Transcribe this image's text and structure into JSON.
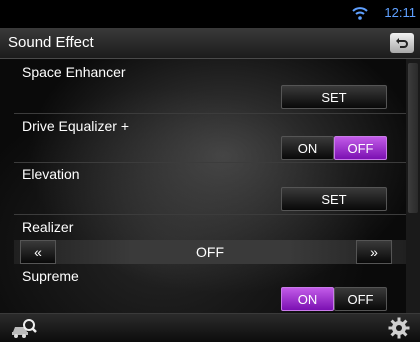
{
  "status": {
    "time": "12:11"
  },
  "header": {
    "title": "Sound Effect",
    "back_icon": "back-arrow-icon"
  },
  "rows": {
    "space_enhancer": {
      "label": "Space Enhancer",
      "button": "SET"
    },
    "drive_equalizer": {
      "label": "Drive Equalizer +",
      "on": "ON",
      "off": "OFF",
      "selected": "OFF"
    },
    "elevation": {
      "label": "Elevation",
      "button": "SET"
    },
    "realizer": {
      "label": "Realizer",
      "prev": "«",
      "value": "OFF",
      "next": "»"
    },
    "supreme": {
      "label": "Supreme",
      "on": "ON",
      "off": "OFF",
      "selected": "ON"
    }
  },
  "footer": {
    "left_icon": "car-search-icon",
    "right_icon": "gear-icon"
  },
  "colors": {
    "accent": "#9d2fd3",
    "clock": "#5fa0ff"
  }
}
